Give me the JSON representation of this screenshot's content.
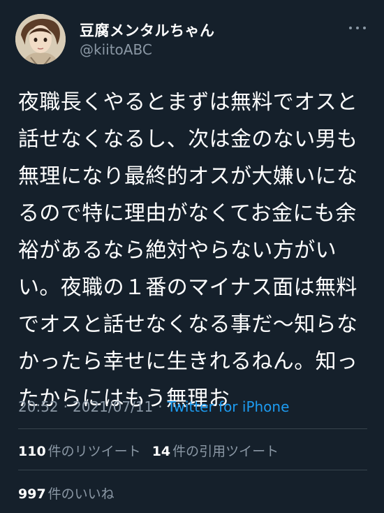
{
  "user": {
    "display_name": "豆腐メンタルちゃん",
    "handle": "@kiitoABC"
  },
  "tweet": {
    "lines": [
      "夜職長くやるとまずは無料でオスと",
      "話せなくなるし、次は金のない男も",
      "無理になり最終的オスが大嫌いにな",
      "るので特に理由がなくてお金にも余",
      "裕があるなら絶対やらない方がい",
      "い。夜職の１番のマイナス面は無料",
      "でオスと話せなくなる事だ〜知らな",
      "かったら幸せに生きれるねん。知っ",
      "たからにはもう無理お"
    ]
  },
  "meta": {
    "time": "20:52",
    "separator": "·",
    "date": "2021/07/11",
    "source": "Twitter for iPhone"
  },
  "stats": {
    "retweets_count": "110",
    "retweets_label": "件のリツイート",
    "quotes_count": "14",
    "quotes_label": "件の引用ツイート",
    "likes_count": "997",
    "likes_label": "件のいいね"
  },
  "icons": {
    "more": "more-horizontal-icon",
    "avatar": "avatar-portrait"
  },
  "colors": {
    "background": "#15202b",
    "text": "#ffffff",
    "secondary": "#8b98a5",
    "link": "#1d9bf0",
    "divider": "#38444d"
  }
}
